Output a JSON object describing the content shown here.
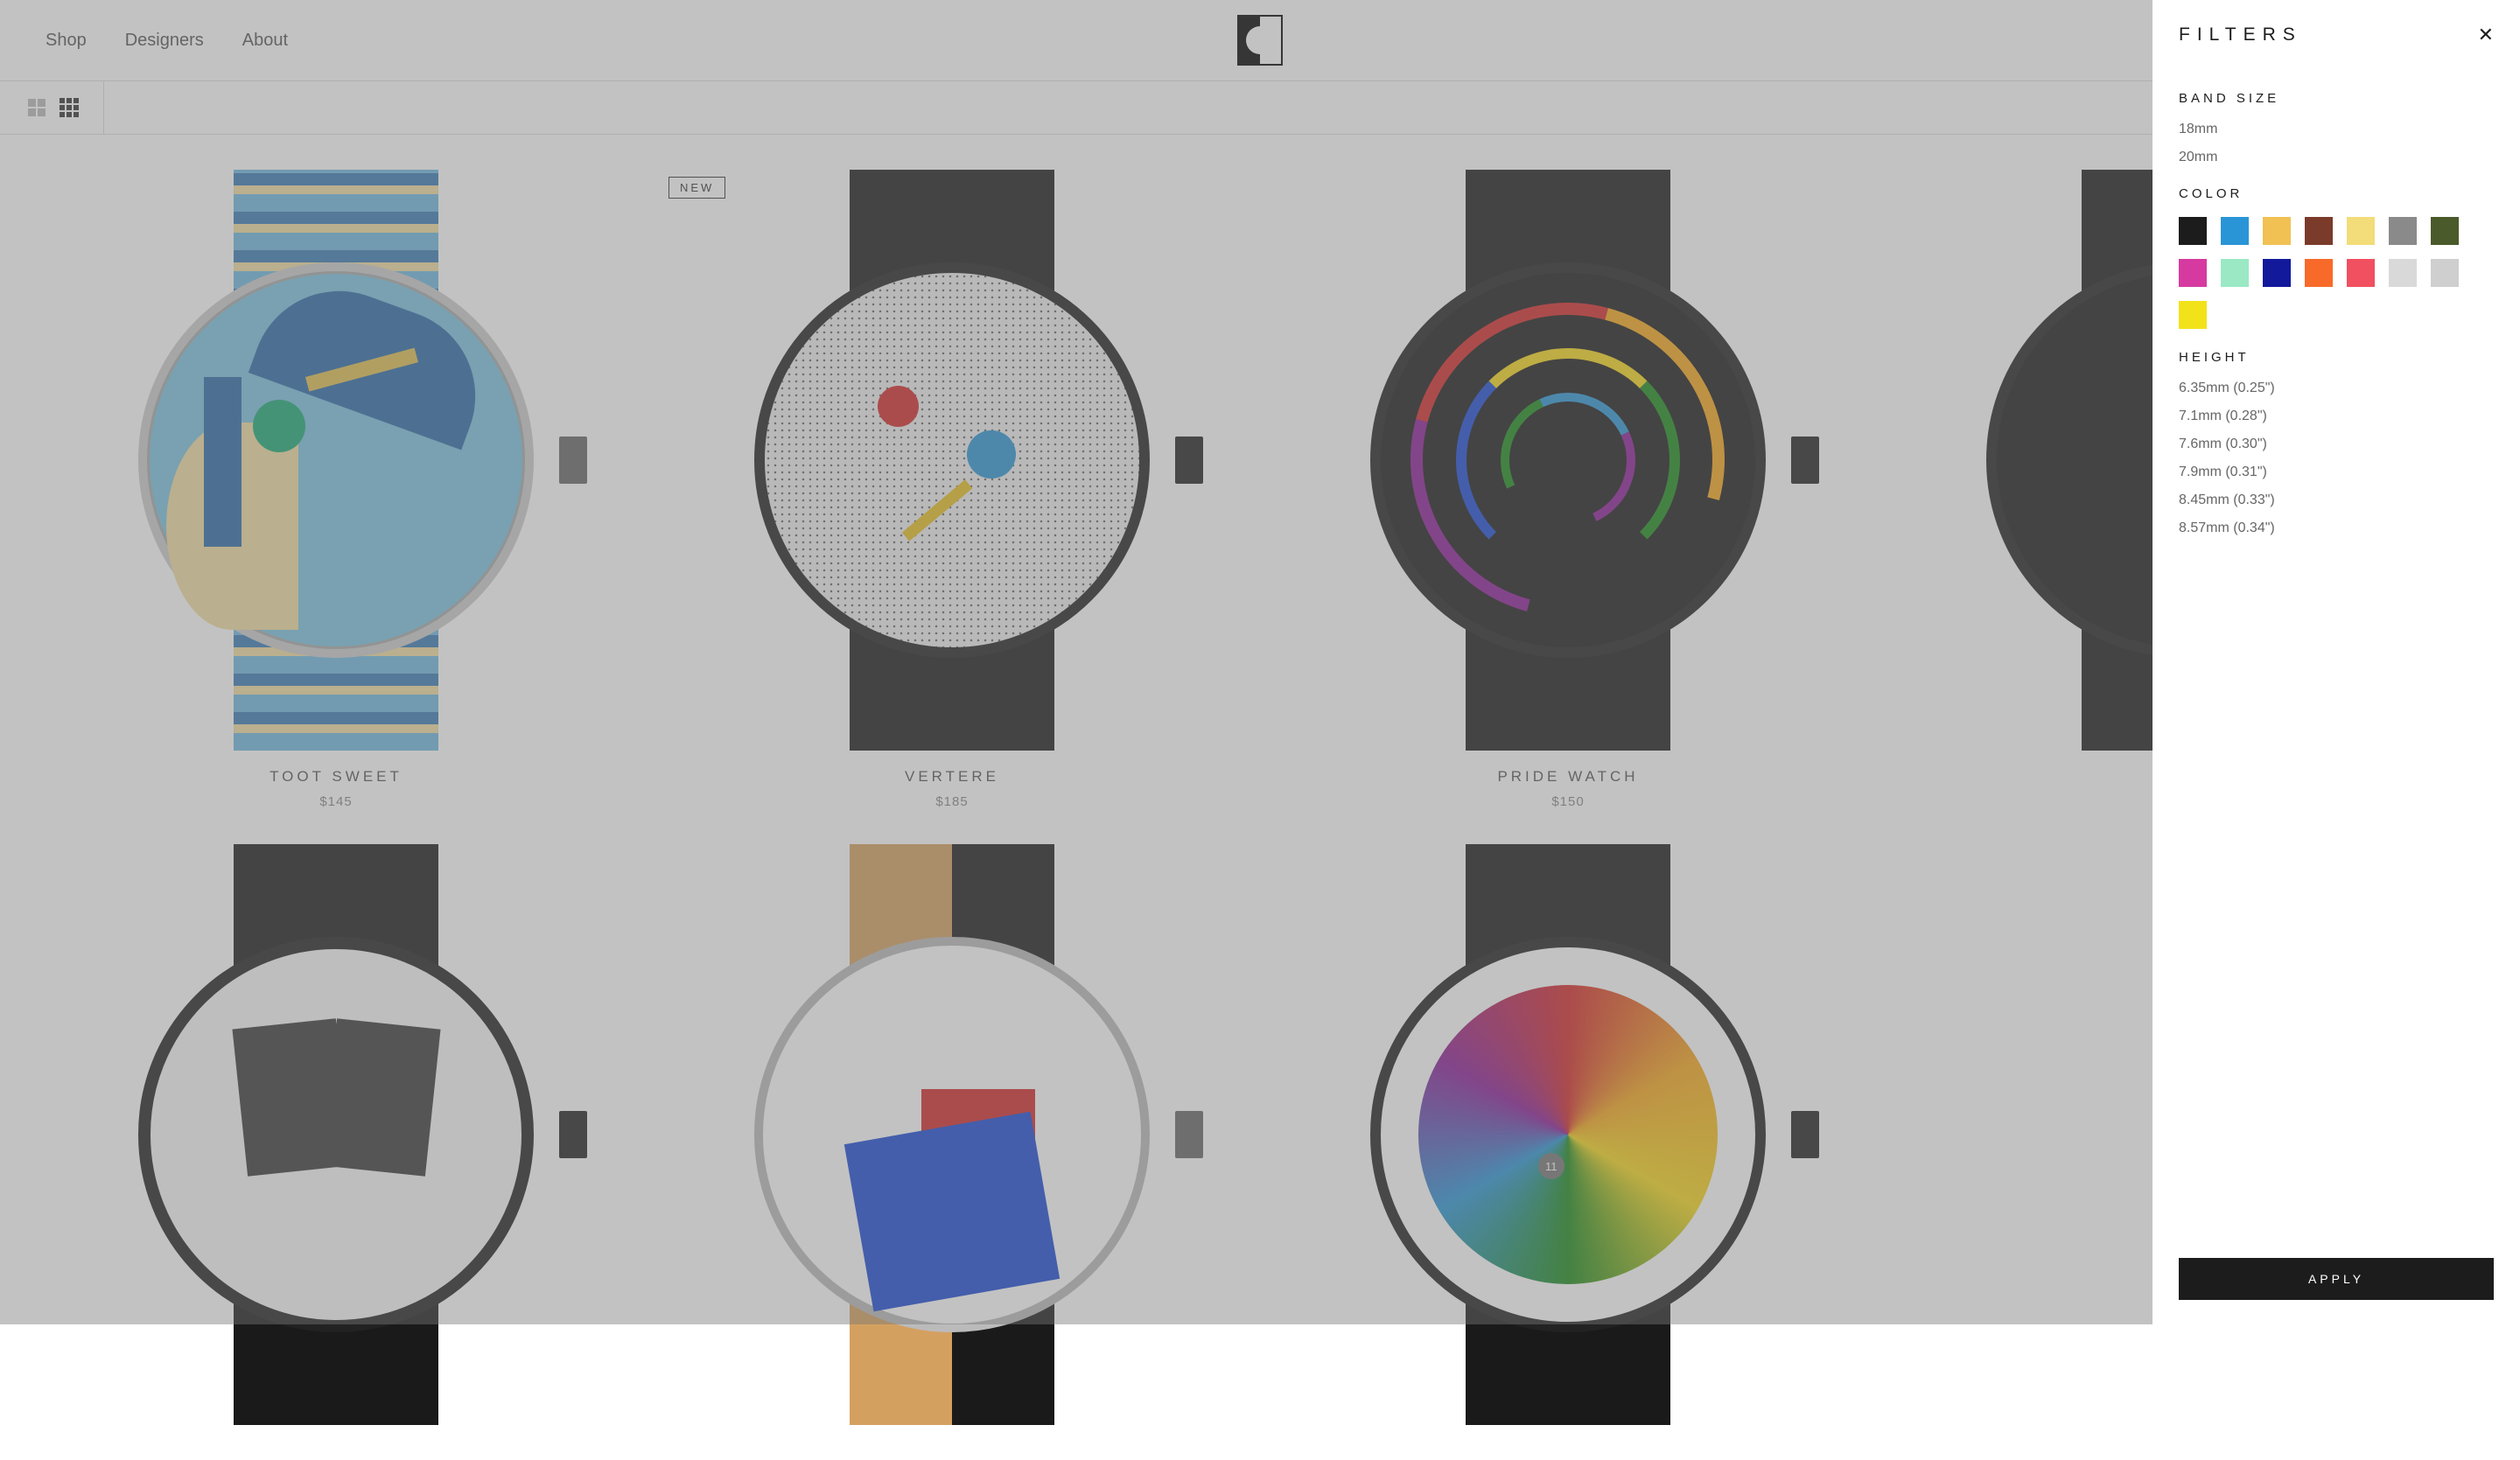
{
  "nav": {
    "links": [
      "Shop",
      "Designers",
      "About"
    ]
  },
  "badge": {
    "new": "NEW"
  },
  "products": [
    {
      "name": "TOOT SWEET",
      "price": "$145"
    },
    {
      "name": "VERTERE",
      "price": "$185",
      "isNew": true
    },
    {
      "name": "PRIDE WATCH",
      "price": "$150"
    },
    {
      "name": "",
      "price": ""
    },
    {
      "name": "",
      "price": ""
    },
    {
      "name": "",
      "price": ""
    },
    {
      "name": "",
      "price": ""
    },
    {
      "name": "",
      "price": ""
    }
  ],
  "filters": {
    "title": "FILTERS",
    "apply": "APPLY",
    "sections": {
      "band_size": {
        "title": "BAND SIZE",
        "options": [
          "18mm",
          "20mm"
        ]
      },
      "color": {
        "title": "COLOR",
        "swatches": [
          "#1c1c1c",
          "#2a95d6",
          "#f1c154",
          "#7a3b2a",
          "#f3dc7a",
          "#8a8a8a",
          "#4a5a2a",
          "#d63aa0",
          "#9ae9c4",
          "#12199b",
          "#f76a2a",
          "#f05060",
          "#d9d9d9",
          "#cfcfcf",
          "#f2e21a"
        ]
      },
      "height": {
        "title": "HEIGHT",
        "options": [
          "6.35mm (0.25\")",
          "7.1mm (0.28\")",
          "7.6mm (0.30\")",
          "7.9mm (0.31\")",
          "8.45mm (0.33\")",
          "8.57mm (0.34\")"
        ]
      }
    }
  },
  "colorful_number": "11"
}
